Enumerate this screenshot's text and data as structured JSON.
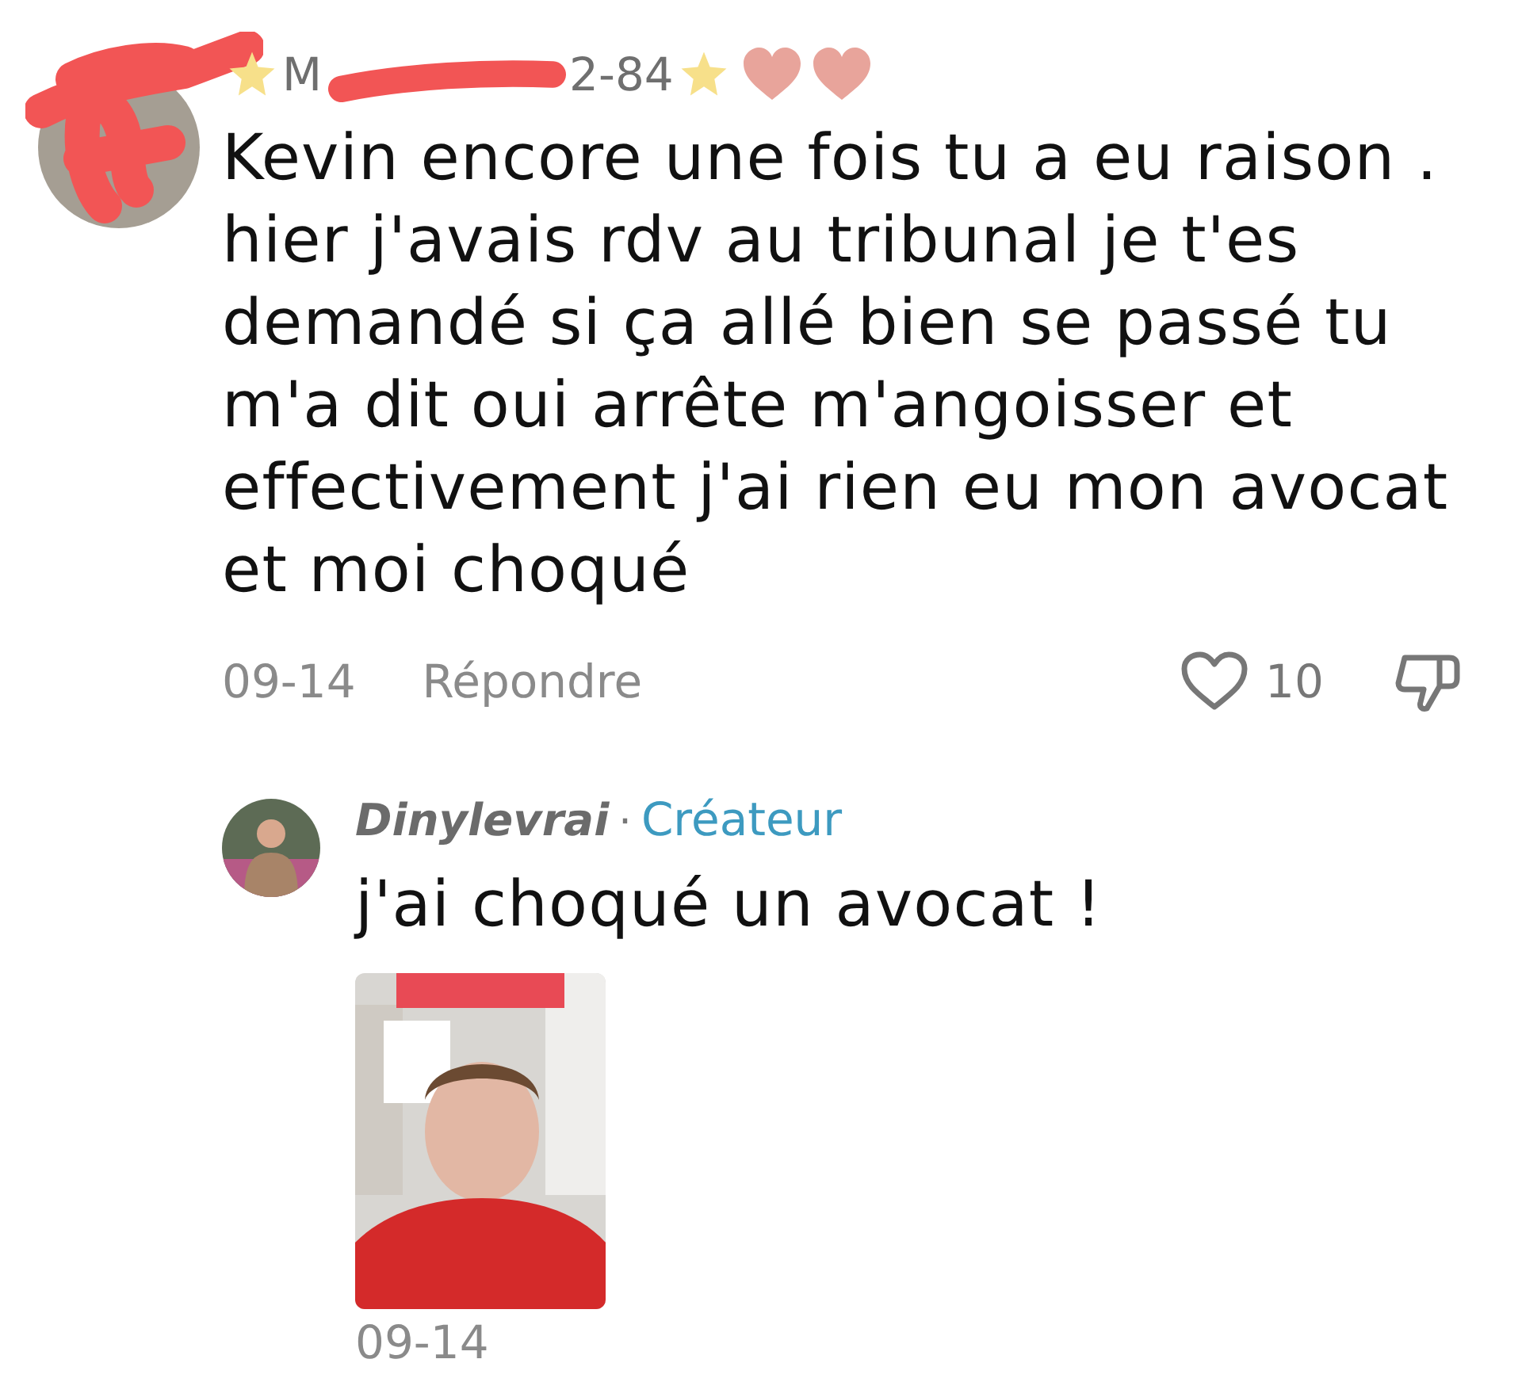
{
  "comment": {
    "username_start": "M",
    "username_end": "2-84",
    "text": "Kevin encore une fois tu a eu raison . hier j'avais rdv au tribunal je t'es demandé si ça allé bien se passé tu m'a dit oui arrête m'angoisser et effectivement j'ai rien eu mon avocat et moi choqué",
    "date": "09-14",
    "reply_label": "Répondre",
    "like_count": "10",
    "liked": false
  },
  "reply": {
    "username": "Dinylevrai",
    "separator": "·",
    "badge": "Créateur",
    "text": "j'ai choqué un avocat !",
    "date": "09-14"
  }
}
